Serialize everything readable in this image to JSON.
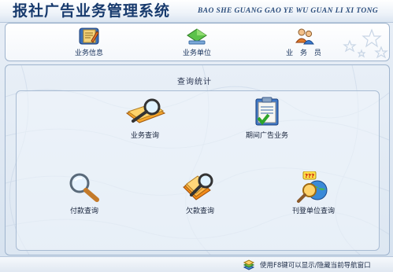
{
  "app": {
    "title": "报社广告业务管理系统",
    "subtitle": "BAO SHE GUANG GAO YE WU GUAN LI XI TONG"
  },
  "nav": {
    "items": [
      {
        "label": "业务信息",
        "icon": "notebook-pencil-icon"
      },
      {
        "label": "业务单位",
        "icon": "green-diamond-icon"
      },
      {
        "label": "业 务 员",
        "icon": "people-icon"
      }
    ]
  },
  "main": {
    "group_label": "查询统计",
    "tiles": [
      {
        "label": "业务查询",
        "icon": "magnifier-folder-icon"
      },
      {
        "label": "期间广告业务",
        "icon": "clipboard-check-icon"
      },
      {
        "label": "付款查询",
        "icon": "magnifier-icon"
      },
      {
        "label": "欠款查询",
        "icon": "magnifier-books-icon"
      },
      {
        "label": "刊登单位查询",
        "icon": "magnifier-globe-icon"
      }
    ]
  },
  "status": {
    "text": "使用F8键可以显示/隐藏当前导航窗口",
    "icon": "stack-icon"
  }
}
